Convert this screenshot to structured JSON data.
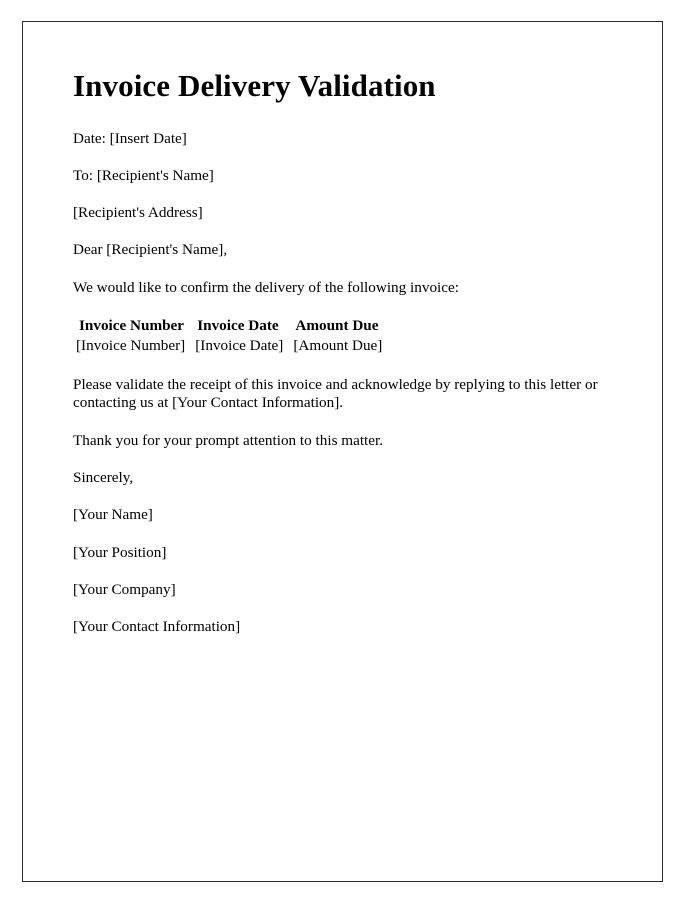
{
  "document": {
    "title": "Invoice Delivery Validation",
    "date_line": "Date: [Insert Date]",
    "to_line": "To: [Recipient's Name]",
    "address_line": "[Recipient's Address]",
    "salutation": "Dear [Recipient's Name],",
    "intro": "We would like to confirm the delivery of the following invoice:",
    "table": {
      "headers": [
        "Invoice Number",
        "Invoice Date",
        "Amount Due"
      ],
      "rows": [
        [
          "[Invoice Number]",
          "[Invoice Date]",
          "[Amount Due]"
        ]
      ]
    },
    "request_paragraph": "Please validate the receipt of this invoice and acknowledge by replying to this letter or contacting us at [Your Contact Information].",
    "thanks_paragraph": "Thank you for your prompt attention to this matter.",
    "closing": "Sincerely,",
    "signature": {
      "name": "[Your Name]",
      "position": "[Your Position]",
      "company": "[Your Company]",
      "contact": "[Your Contact Information]"
    }
  },
  "colors": {
    "text": "#000000",
    "border": "#2b2b2b",
    "page_background": "#ffffff"
  }
}
